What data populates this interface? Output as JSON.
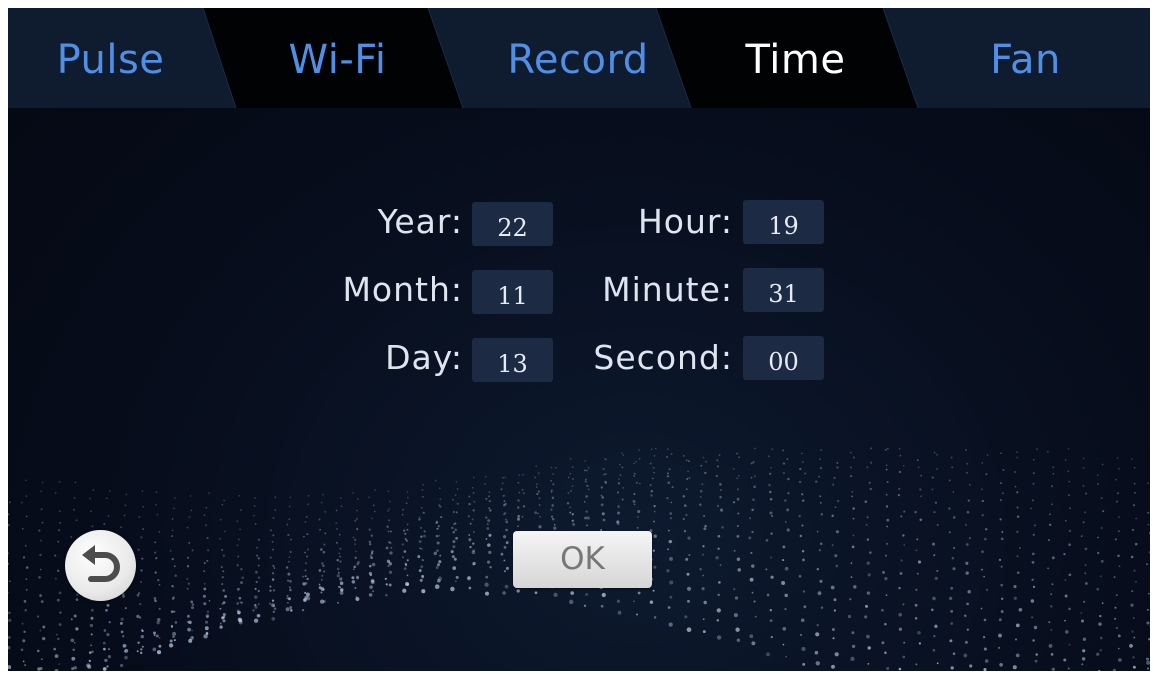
{
  "tabs": [
    {
      "label": "Pulse",
      "active": false
    },
    {
      "label": "Wi-Fi",
      "active": false
    },
    {
      "label": "Record",
      "active": false
    },
    {
      "label": "Time",
      "active": true
    },
    {
      "label": "Fan",
      "active": false
    }
  ],
  "time_settings": {
    "year": {
      "label": "Year:",
      "value": "22"
    },
    "month": {
      "label": "Month:",
      "value": "11"
    },
    "day": {
      "label": "Day:",
      "value": "13"
    },
    "hour": {
      "label": "Hour:",
      "value": "19"
    },
    "minute": {
      "label": "Minute:",
      "value": "31"
    },
    "second": {
      "label": "Second:",
      "value": "00"
    }
  },
  "ok_button": {
    "label": "OK"
  },
  "back_button": {
    "icon": "undo-arrow-icon"
  },
  "colors": {
    "tab_inactive_text": "#4f8fe6",
    "tab_active_text": "#ffffff",
    "field_background": "#1c2a44",
    "screen_background": "#070d1c"
  }
}
